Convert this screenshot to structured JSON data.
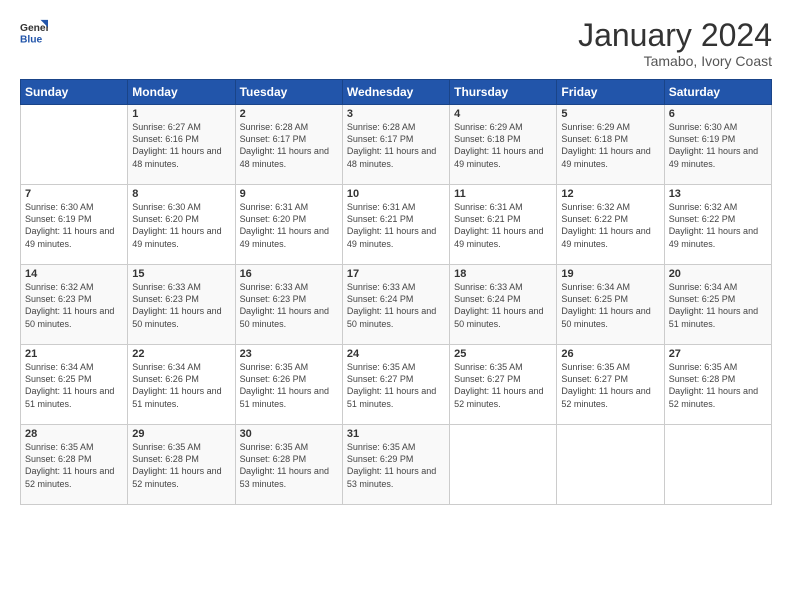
{
  "header": {
    "logo_general": "General",
    "logo_blue": "Blue",
    "title": "January 2024",
    "location": "Tamabo, Ivory Coast"
  },
  "days_of_week": [
    "Sunday",
    "Monday",
    "Tuesday",
    "Wednesday",
    "Thursday",
    "Friday",
    "Saturday"
  ],
  "weeks": [
    [
      {
        "day": "",
        "sunrise": "",
        "sunset": "",
        "daylight": ""
      },
      {
        "day": "1",
        "sunrise": "Sunrise: 6:27 AM",
        "sunset": "Sunset: 6:16 PM",
        "daylight": "Daylight: 11 hours and 48 minutes."
      },
      {
        "day": "2",
        "sunrise": "Sunrise: 6:28 AM",
        "sunset": "Sunset: 6:17 PM",
        "daylight": "Daylight: 11 hours and 48 minutes."
      },
      {
        "day": "3",
        "sunrise": "Sunrise: 6:28 AM",
        "sunset": "Sunset: 6:17 PM",
        "daylight": "Daylight: 11 hours and 48 minutes."
      },
      {
        "day": "4",
        "sunrise": "Sunrise: 6:29 AM",
        "sunset": "Sunset: 6:18 PM",
        "daylight": "Daylight: 11 hours and 49 minutes."
      },
      {
        "day": "5",
        "sunrise": "Sunrise: 6:29 AM",
        "sunset": "Sunset: 6:18 PM",
        "daylight": "Daylight: 11 hours and 49 minutes."
      },
      {
        "day": "6",
        "sunrise": "Sunrise: 6:30 AM",
        "sunset": "Sunset: 6:19 PM",
        "daylight": "Daylight: 11 hours and 49 minutes."
      }
    ],
    [
      {
        "day": "7",
        "sunrise": "Sunrise: 6:30 AM",
        "sunset": "Sunset: 6:19 PM",
        "daylight": "Daylight: 11 hours and 49 minutes."
      },
      {
        "day": "8",
        "sunrise": "Sunrise: 6:30 AM",
        "sunset": "Sunset: 6:20 PM",
        "daylight": "Daylight: 11 hours and 49 minutes."
      },
      {
        "day": "9",
        "sunrise": "Sunrise: 6:31 AM",
        "sunset": "Sunset: 6:20 PM",
        "daylight": "Daylight: 11 hours and 49 minutes."
      },
      {
        "day": "10",
        "sunrise": "Sunrise: 6:31 AM",
        "sunset": "Sunset: 6:21 PM",
        "daylight": "Daylight: 11 hours and 49 minutes."
      },
      {
        "day": "11",
        "sunrise": "Sunrise: 6:31 AM",
        "sunset": "Sunset: 6:21 PM",
        "daylight": "Daylight: 11 hours and 49 minutes."
      },
      {
        "day": "12",
        "sunrise": "Sunrise: 6:32 AM",
        "sunset": "Sunset: 6:22 PM",
        "daylight": "Daylight: 11 hours and 49 minutes."
      },
      {
        "day": "13",
        "sunrise": "Sunrise: 6:32 AM",
        "sunset": "Sunset: 6:22 PM",
        "daylight": "Daylight: 11 hours and 49 minutes."
      }
    ],
    [
      {
        "day": "14",
        "sunrise": "Sunrise: 6:32 AM",
        "sunset": "Sunset: 6:23 PM",
        "daylight": "Daylight: 11 hours and 50 minutes."
      },
      {
        "day": "15",
        "sunrise": "Sunrise: 6:33 AM",
        "sunset": "Sunset: 6:23 PM",
        "daylight": "Daylight: 11 hours and 50 minutes."
      },
      {
        "day": "16",
        "sunrise": "Sunrise: 6:33 AM",
        "sunset": "Sunset: 6:23 PM",
        "daylight": "Daylight: 11 hours and 50 minutes."
      },
      {
        "day": "17",
        "sunrise": "Sunrise: 6:33 AM",
        "sunset": "Sunset: 6:24 PM",
        "daylight": "Daylight: 11 hours and 50 minutes."
      },
      {
        "day": "18",
        "sunrise": "Sunrise: 6:33 AM",
        "sunset": "Sunset: 6:24 PM",
        "daylight": "Daylight: 11 hours and 50 minutes."
      },
      {
        "day": "19",
        "sunrise": "Sunrise: 6:34 AM",
        "sunset": "Sunset: 6:25 PM",
        "daylight": "Daylight: 11 hours and 50 minutes."
      },
      {
        "day": "20",
        "sunrise": "Sunrise: 6:34 AM",
        "sunset": "Sunset: 6:25 PM",
        "daylight": "Daylight: 11 hours and 51 minutes."
      }
    ],
    [
      {
        "day": "21",
        "sunrise": "Sunrise: 6:34 AM",
        "sunset": "Sunset: 6:25 PM",
        "daylight": "Daylight: 11 hours and 51 minutes."
      },
      {
        "day": "22",
        "sunrise": "Sunrise: 6:34 AM",
        "sunset": "Sunset: 6:26 PM",
        "daylight": "Daylight: 11 hours and 51 minutes."
      },
      {
        "day": "23",
        "sunrise": "Sunrise: 6:35 AM",
        "sunset": "Sunset: 6:26 PM",
        "daylight": "Daylight: 11 hours and 51 minutes."
      },
      {
        "day": "24",
        "sunrise": "Sunrise: 6:35 AM",
        "sunset": "Sunset: 6:27 PM",
        "daylight": "Daylight: 11 hours and 51 minutes."
      },
      {
        "day": "25",
        "sunrise": "Sunrise: 6:35 AM",
        "sunset": "Sunset: 6:27 PM",
        "daylight": "Daylight: 11 hours and 52 minutes."
      },
      {
        "day": "26",
        "sunrise": "Sunrise: 6:35 AM",
        "sunset": "Sunset: 6:27 PM",
        "daylight": "Daylight: 11 hours and 52 minutes."
      },
      {
        "day": "27",
        "sunrise": "Sunrise: 6:35 AM",
        "sunset": "Sunset: 6:28 PM",
        "daylight": "Daylight: 11 hours and 52 minutes."
      }
    ],
    [
      {
        "day": "28",
        "sunrise": "Sunrise: 6:35 AM",
        "sunset": "Sunset: 6:28 PM",
        "daylight": "Daylight: 11 hours and 52 minutes."
      },
      {
        "day": "29",
        "sunrise": "Sunrise: 6:35 AM",
        "sunset": "Sunset: 6:28 PM",
        "daylight": "Daylight: 11 hours and 52 minutes."
      },
      {
        "day": "30",
        "sunrise": "Sunrise: 6:35 AM",
        "sunset": "Sunset: 6:28 PM",
        "daylight": "Daylight: 11 hours and 53 minutes."
      },
      {
        "day": "31",
        "sunrise": "Sunrise: 6:35 AM",
        "sunset": "Sunset: 6:29 PM",
        "daylight": "Daylight: 11 hours and 53 minutes."
      },
      {
        "day": "",
        "sunrise": "",
        "sunset": "",
        "daylight": ""
      },
      {
        "day": "",
        "sunrise": "",
        "sunset": "",
        "daylight": ""
      },
      {
        "day": "",
        "sunrise": "",
        "sunset": "",
        "daylight": ""
      }
    ]
  ]
}
